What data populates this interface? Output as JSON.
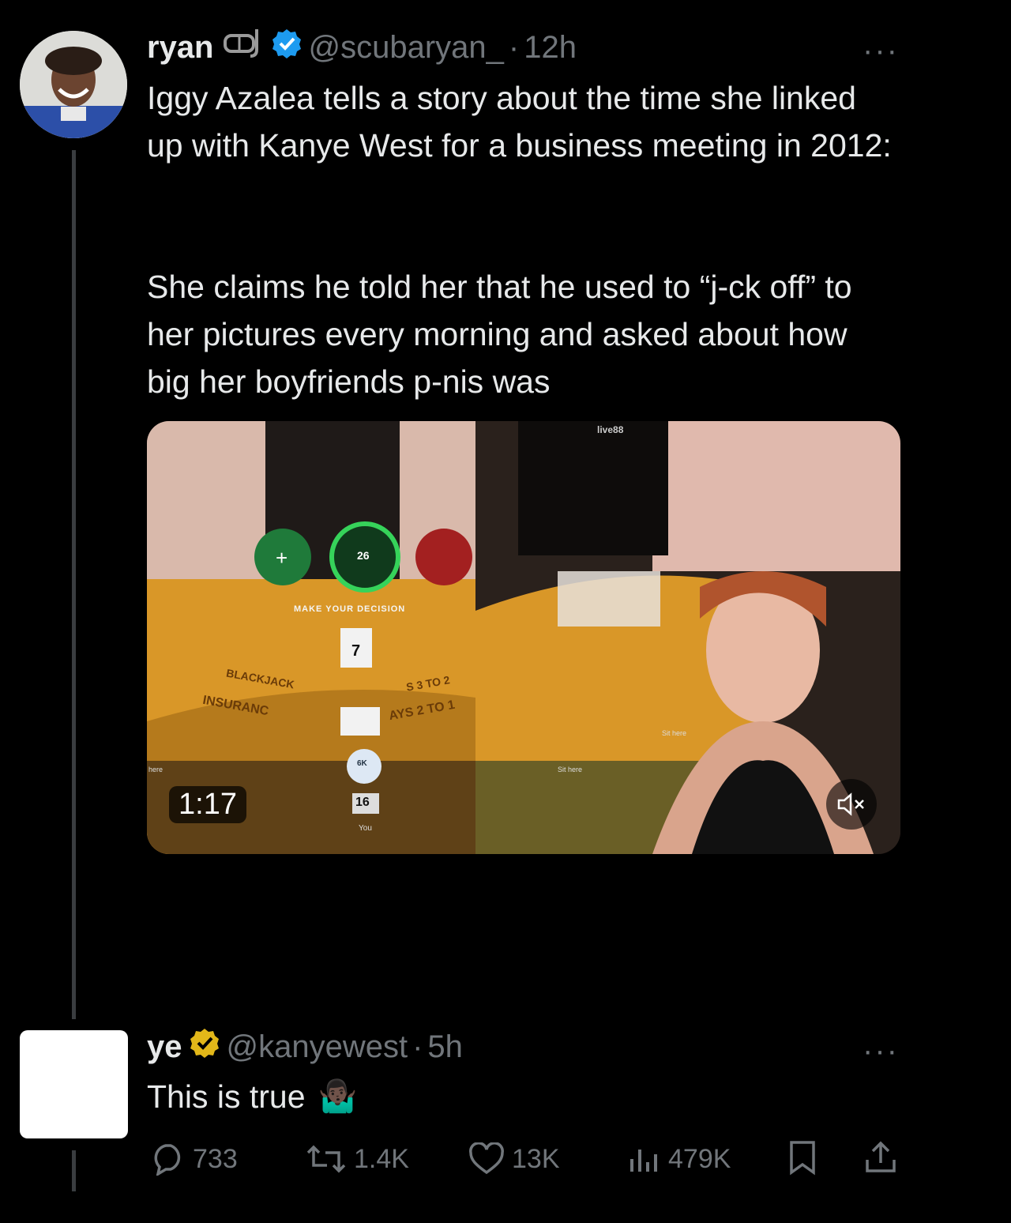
{
  "tweet": {
    "author_name": "ryan",
    "author_handle": "@scubaryan_",
    "separator": "·",
    "time": "12h",
    "more_label": "···",
    "paragraphs": [
      "Iggy Azalea tells a story about the time she linked up with Kanye West for a business meeting in 2012:",
      "She claims he told her that he used to “j-ck off” to her pictures every morning and asked about how big her boyfriends p-nis was"
    ],
    "video": {
      "duration": "1:17",
      "overlay_left": {
        "button_add": "+",
        "timer": "26",
        "prompt": "MAKE YOUR DECISION",
        "card_value": "7",
        "table_text_1": "BLACKJACK",
        "table_text_2": "INSURANC",
        "table_text_3": "S 3 TO 2",
        "table_text_4": "AYS 2 TO 1",
        "chip_label": "6K",
        "score": "16",
        "player_label": "You",
        "seat_label": "here"
      },
      "overlay_right": {
        "brand": "live88",
        "seat_label_1": "Sit here",
        "seat_label_2": "Sit here"
      },
      "mute_icon": "speaker-muted-icon"
    }
  },
  "reply": {
    "author_name": "ye",
    "author_handle": "@kanyewest",
    "separator": "·",
    "time": "5h",
    "more_label": "···",
    "text": "This is true",
    "emoji": "🤷🏿‍♂️",
    "actions": {
      "replies": "733",
      "reposts": "1.4K",
      "likes": "13K",
      "views": "479K"
    }
  },
  "colors": {
    "background": "#000000",
    "text": "#e7e9ea",
    "muted": "#71767b",
    "verified_blue": "#1d9bf0",
    "verified_gold": "#e2b719"
  }
}
